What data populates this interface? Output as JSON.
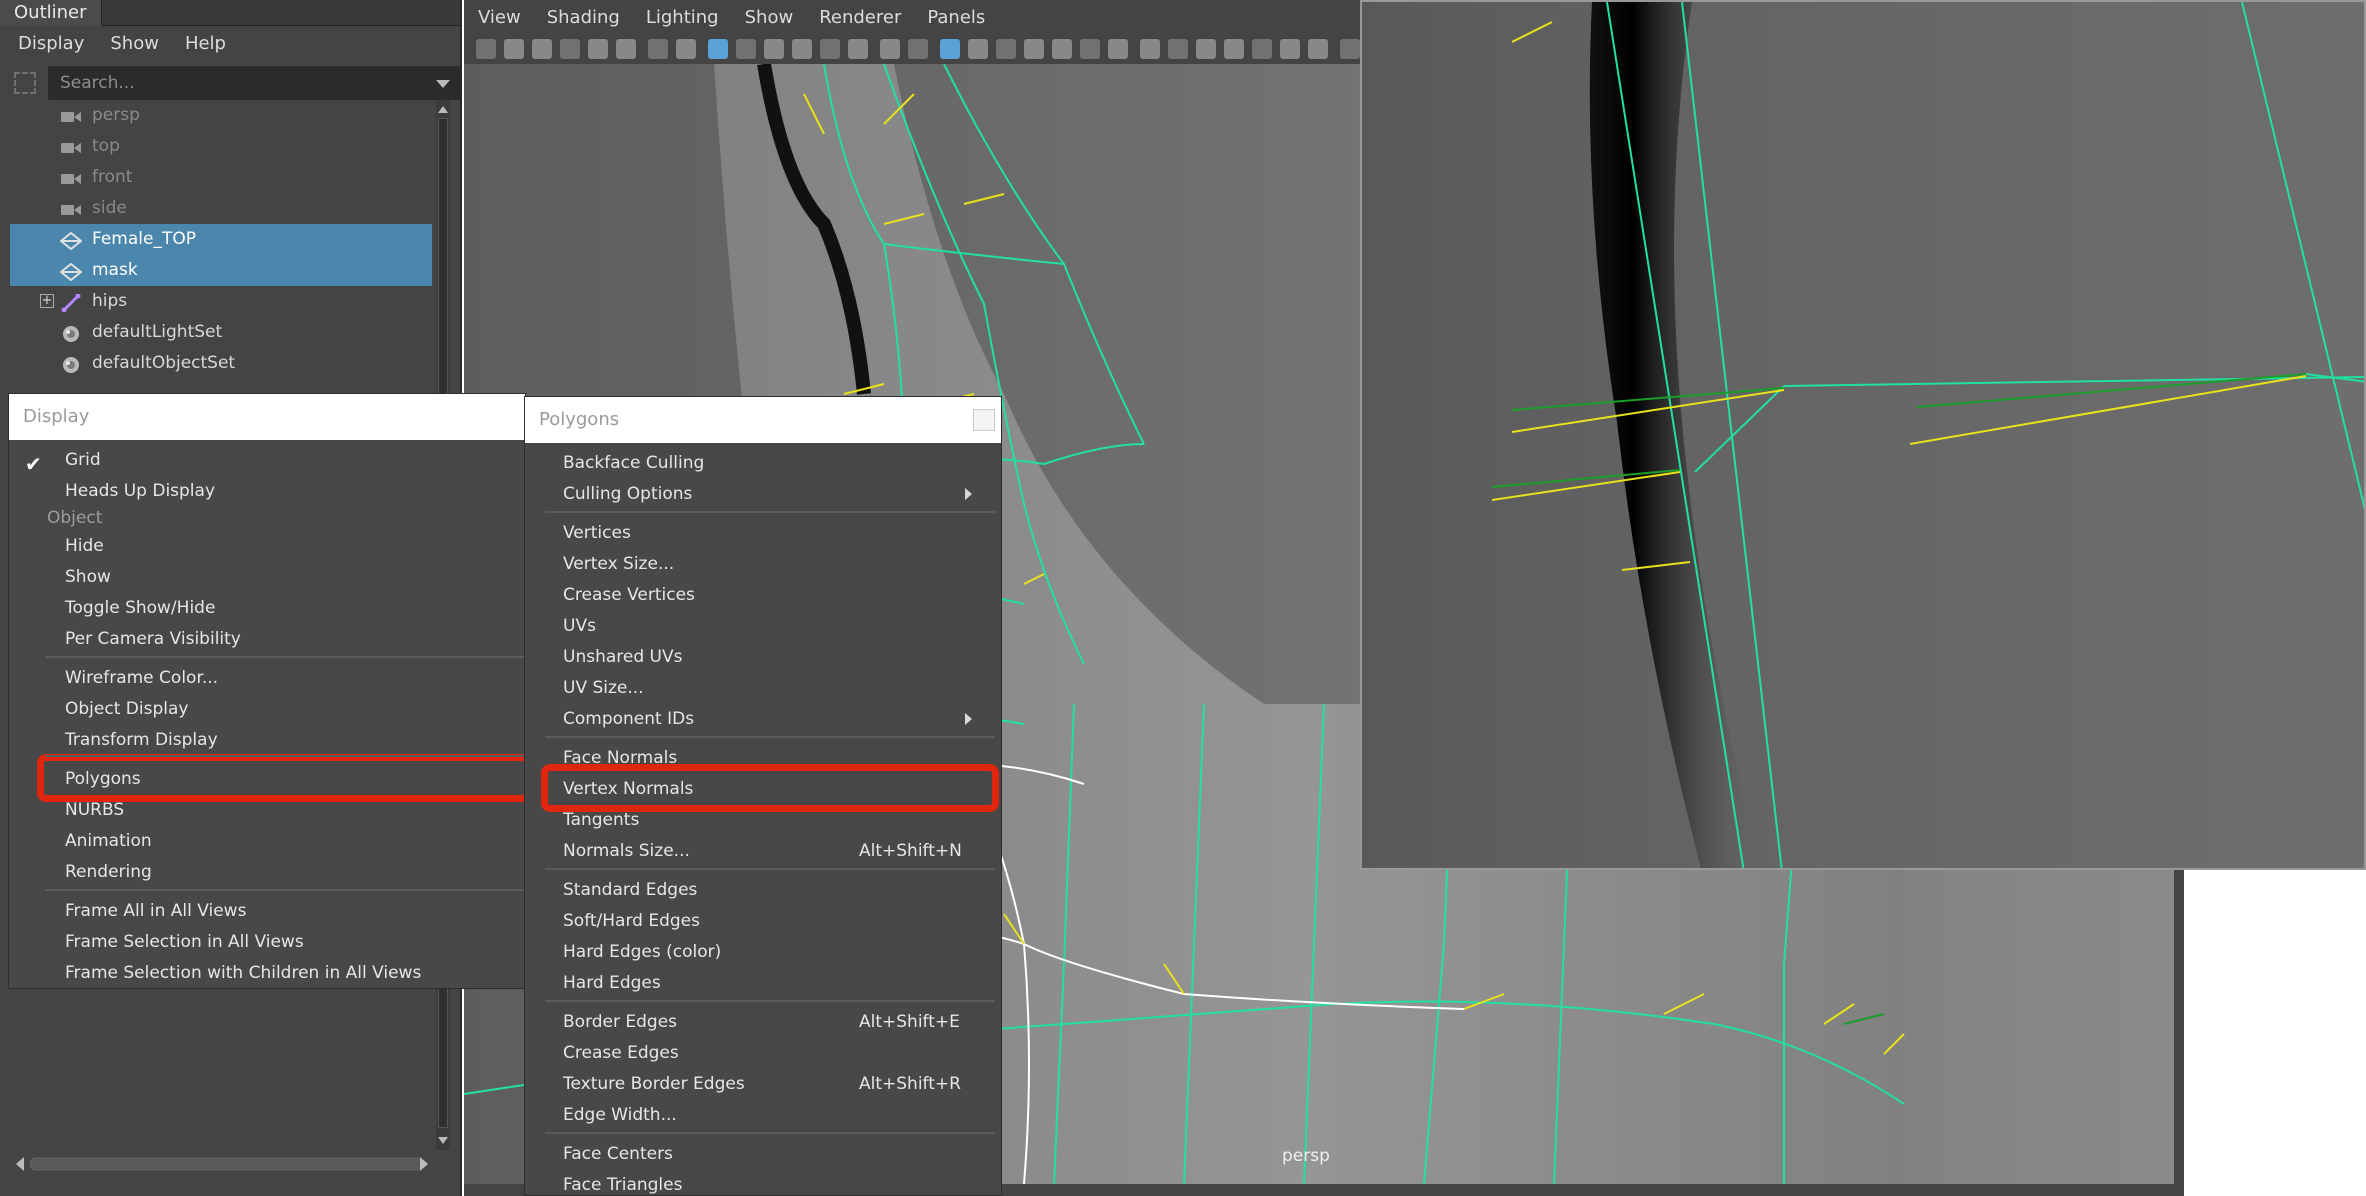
{
  "outliner": {
    "title": "Outliner",
    "menu": [
      "Display",
      "Show",
      "Help"
    ],
    "search_placeholder": "Search...",
    "items": [
      {
        "label": "persp",
        "icon": "camera-icon",
        "state": "hidden"
      },
      {
        "label": "top",
        "icon": "camera-icon",
        "state": "hidden"
      },
      {
        "label": "front",
        "icon": "camera-icon",
        "state": "hidden"
      },
      {
        "label": "side",
        "icon": "camera-icon",
        "state": "hidden"
      },
      {
        "label": "Female_TOP",
        "icon": "mesh-icon",
        "state": "selected"
      },
      {
        "label": "mask",
        "icon": "mesh-icon",
        "state": "selected"
      },
      {
        "label": "hips",
        "icon": "joint-icon",
        "state": "normal",
        "expandable": true
      },
      {
        "label": "defaultLightSet",
        "icon": "set-icon",
        "state": "normal"
      },
      {
        "label": "defaultObjectSet",
        "icon": "set-icon",
        "state": "normal"
      }
    ]
  },
  "viewport": {
    "menu": [
      "View",
      "Shading",
      "Lighting",
      "Show",
      "Renderer",
      "Panels"
    ],
    "camera_label": "persp"
  },
  "display_menu": {
    "title": "Display",
    "items": [
      {
        "label": "Grid",
        "checked": true
      },
      {
        "label": "Heads Up Display"
      },
      {
        "label": "Object",
        "header": true
      },
      {
        "label": "Hide"
      },
      {
        "label": "Show"
      },
      {
        "label": "Toggle Show/Hide"
      },
      {
        "label": "Per Camera Visibility"
      },
      {
        "label": "Wireframe Color..."
      },
      {
        "label": "Object Display"
      },
      {
        "label": "Transform Display"
      },
      {
        "label": "Polygons",
        "highlighted": true
      },
      {
        "label": "NURBS"
      },
      {
        "label": "Animation"
      },
      {
        "label": "Rendering"
      },
      {
        "label": "Frame All in All Views"
      },
      {
        "label": "Frame Selection in All Views"
      },
      {
        "label": "Frame Selection with Children in All Views"
      }
    ]
  },
  "polygons_menu": {
    "title": "Polygons",
    "items": [
      {
        "label": "Backface Culling"
      },
      {
        "label": "Culling Options",
        "submenu": true
      },
      {
        "label": "Vertices"
      },
      {
        "label": "Vertex Size..."
      },
      {
        "label": "Crease Vertices"
      },
      {
        "label": "UVs"
      },
      {
        "label": "Unshared UVs"
      },
      {
        "label": "UV Size..."
      },
      {
        "label": "Component IDs",
        "submenu": true
      },
      {
        "label": "Face Normals"
      },
      {
        "label": "Vertex Normals",
        "highlighted": true
      },
      {
        "label": "Tangents"
      },
      {
        "label": "Normals Size...",
        "shortcut": "Alt+Shift+N"
      },
      {
        "label": "Standard Edges"
      },
      {
        "label": "Soft/Hard Edges"
      },
      {
        "label": "Hard Edges (color)"
      },
      {
        "label": "Hard Edges"
      },
      {
        "label": "Border Edges",
        "shortcut": "Alt+Shift+E"
      },
      {
        "label": "Crease Edges"
      },
      {
        "label": "Texture Border Edges",
        "shortcut": "Alt+Shift+R"
      },
      {
        "label": "Edge Width..."
      },
      {
        "label": "Face Centers"
      },
      {
        "label": "Face Triangles"
      }
    ]
  },
  "colors": {
    "highlight_red": "#e0260f",
    "selection_blue": "#4b86ad",
    "wire_green": "#21e0a4",
    "normal_yellow": "#e7e21a"
  }
}
